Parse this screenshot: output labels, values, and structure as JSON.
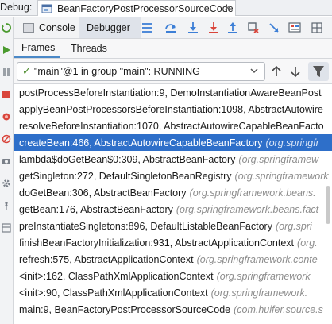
{
  "top_bar": {
    "debug_label": "Debug:",
    "tab_title": "BeanFactoryPostProcessorSourceCode",
    "close_glyph": "×"
  },
  "toolbar": {
    "console_label": "Console",
    "debugger_label": "Debugger",
    "icons": [
      "list-lines-icon",
      "step-over-icon",
      "step-into-icon",
      "force-step-into-icon",
      "step-out-icon",
      "drop-frame-icon",
      "run-to-cursor-icon",
      "evaluate-icon",
      "grid-icon"
    ]
  },
  "subtabs": {
    "frames_label": "Frames",
    "threads_label": "Threads"
  },
  "thread_selector": {
    "check": "✓",
    "value": "\"main\"@1 in group \"main\": RUNNING"
  },
  "frames": [
    {
      "method": "postProcessBeforeInstantiation:9, DemoInstantiationAwareBeanPost",
      "pkg": "",
      "selected": false
    },
    {
      "method": "applyBeanPostProcessorsBeforeInstantiation:1098, AbstractAutowire",
      "pkg": "",
      "selected": false
    },
    {
      "method": "resolveBeforeInstantiation:1070, AbstractAutowireCapableBeanFacto",
      "pkg": "",
      "selected": false
    },
    {
      "method": "createBean:466, AbstractAutowireCapableBeanFactory",
      "pkg": "(org.springfr",
      "selected": true
    },
    {
      "method": "lambda$doGetBean$0:309, AbstractBeanFactory",
      "pkg": "(org.springframew",
      "selected": false
    },
    {
      "method": "getSingleton:272, DefaultSingletonBeanRegistry",
      "pkg": "(org.springframework",
      "selected": false
    },
    {
      "method": "doGetBean:306, AbstractBeanFactory",
      "pkg": "(org.springframework.beans.",
      "selected": false
    },
    {
      "method": "getBean:176, AbstractBeanFactory",
      "pkg": "(org.springframework.beans.fact",
      "selected": false
    },
    {
      "method": "preInstantiateSingletons:896, DefaultListableBeanFactory",
      "pkg": "(org.spri",
      "selected": false
    },
    {
      "method": "finishBeanFactoryInitialization:931, AbstractApplicationContext",
      "pkg": "(org.",
      "selected": false
    },
    {
      "method": "refresh:575, AbstractApplicationContext",
      "pkg": "(org.springframework.conte",
      "selected": false
    },
    {
      "method": "<init>:162, ClassPathXmlApplicationContext",
      "pkg": "(org.springframework",
      "selected": false
    },
    {
      "method": "<init>:90, ClassPathXmlApplicationContext",
      "pkg": "(org.springframework.",
      "selected": false
    },
    {
      "method": "main:9, BeanFactoryPostProcessorSourceCode",
      "pkg": "(com.huifer.source.s",
      "selected": false
    }
  ],
  "colors": {
    "selection": "#2e6fc9",
    "package_text": "#8d8d8d",
    "step_blue": "#3d7fd6",
    "step_red": "#d9453b",
    "run_green": "#4a9a2e"
  }
}
